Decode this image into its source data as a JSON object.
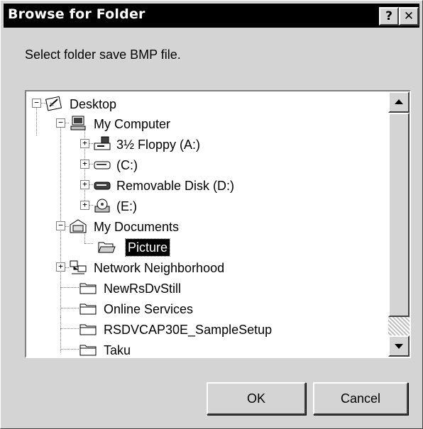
{
  "window": {
    "title": "Browse for Folder",
    "help_label": "?",
    "close_label": "✕"
  },
  "prompt": "Select folder save BMP file.",
  "tree": {
    "items": [
      {
        "label": "Desktop",
        "icon": "desktop-icon",
        "expander": "−"
      },
      {
        "label": "My Computer",
        "icon": "my-computer-icon",
        "expander": "−"
      },
      {
        "label": "3½ Floppy (A:)",
        "icon": "floppy-drive-icon",
        "expander": "+"
      },
      {
        "label": "(C:)",
        "icon": "hard-drive-icon",
        "expander": "+"
      },
      {
        "label": "Removable Disk (D:)",
        "icon": "removable-disk-icon",
        "expander": "+"
      },
      {
        "label": "(E:)",
        "icon": "cd-drive-icon",
        "expander": "+"
      },
      {
        "label": "My Documents",
        "icon": "my-documents-icon",
        "expander": "−"
      },
      {
        "label": "Picture",
        "icon": "open-folder-icon",
        "selected": true
      },
      {
        "label": "Network Neighborhood",
        "icon": "network-neighborhood-icon",
        "expander": "+"
      },
      {
        "label": "NewRsDvStill",
        "icon": "folder-icon"
      },
      {
        "label": "Online Services",
        "icon": "folder-icon"
      },
      {
        "label": "RSDVCAP30E_SampleSetup",
        "icon": "folder-icon"
      },
      {
        "label": "Taku",
        "icon": "folder-icon"
      }
    ]
  },
  "buttons": {
    "ok": "OK",
    "cancel": "Cancel"
  }
}
